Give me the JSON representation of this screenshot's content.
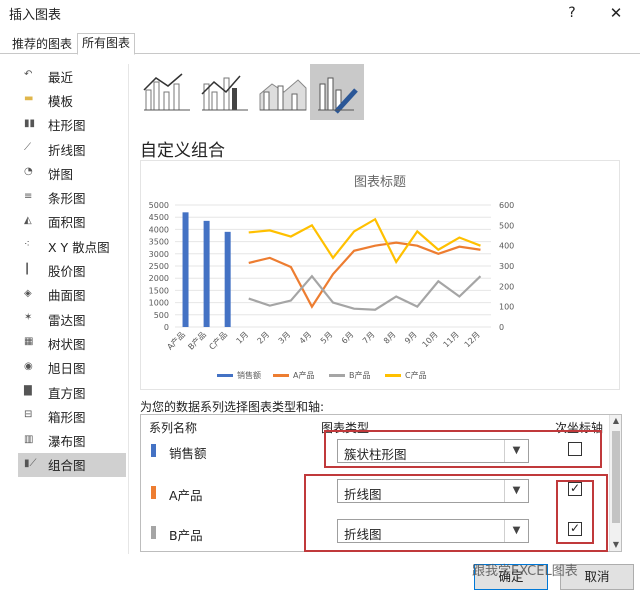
{
  "window": {
    "title": "插入图表",
    "help": "?",
    "close": "✕"
  },
  "tabs": [
    {
      "label": "推荐的图表"
    },
    {
      "label": "所有图表"
    }
  ],
  "sidebar": {
    "items": [
      {
        "label": "最近",
        "icon": "recent-icon"
      },
      {
        "label": "模板",
        "icon": "folder-icon"
      },
      {
        "label": "柱形图",
        "icon": "column-chart-icon"
      },
      {
        "label": "折线图",
        "icon": "line-chart-icon"
      },
      {
        "label": "饼图",
        "icon": "pie-chart-icon"
      },
      {
        "label": "条形图",
        "icon": "bar-chart-icon"
      },
      {
        "label": "面积图",
        "icon": "area-chart-icon"
      },
      {
        "label": "X Y 散点图",
        "icon": "scatter-chart-icon"
      },
      {
        "label": "股价图",
        "icon": "stock-chart-icon"
      },
      {
        "label": "曲面图",
        "icon": "surface-chart-icon"
      },
      {
        "label": "雷达图",
        "icon": "radar-chart-icon"
      },
      {
        "label": "树状图",
        "icon": "treemap-chart-icon"
      },
      {
        "label": "旭日图",
        "icon": "sunburst-chart-icon"
      },
      {
        "label": "直方图",
        "icon": "histogram-chart-icon"
      },
      {
        "label": "箱形图",
        "icon": "boxwhisker-chart-icon"
      },
      {
        "label": "瀑布图",
        "icon": "waterfall-chart-icon"
      },
      {
        "label": "组合图",
        "icon": "combo-chart-icon"
      }
    ],
    "active_index": 16
  },
  "section_title": "自定义组合",
  "select_caption": "为您的数据系列选择图表类型和轴:",
  "table": {
    "headers": {
      "name": "系列名称",
      "type": "图表类型",
      "axis": "次坐标轴"
    },
    "rows": [
      {
        "name": "销售额",
        "type": "簇状柱形图",
        "secondary": false,
        "color": "#4472C4"
      },
      {
        "name": "A产品",
        "type": "折线图",
        "secondary": true,
        "color": "#ED7D31"
      },
      {
        "name": "B产品",
        "type": "折线图",
        "secondary": true,
        "color": "#A5A5A5"
      }
    ]
  },
  "buttons": {
    "ok": "确定",
    "cancel": "取消"
  },
  "watermark": "跟我学EXCEL图表",
  "chart_data": {
    "type": "bar",
    "title": "图表标题",
    "categories": [
      "A产品",
      "B产品",
      "C产品",
      "1月",
      "2月",
      "3月",
      "4月",
      "5月",
      "6月",
      "7月",
      "8月",
      "9月",
      "10月",
      "11月",
      "12月"
    ],
    "series": [
      {
        "name": "销售额",
        "type": "bar",
        "axis": "primary",
        "color": "#4472C4",
        "values": [
          4700,
          4350,
          3900,
          null,
          null,
          null,
          null,
          null,
          null,
          null,
          null,
          null,
          null,
          null,
          null
        ]
      },
      {
        "name": "A产品",
        "type": "line",
        "axis": "secondary",
        "color": "#ED7D31",
        "values": [
          null,
          null,
          null,
          315,
          340,
          295,
          100,
          260,
          375,
          400,
          415,
          400,
          360,
          395,
          380
        ]
      },
      {
        "name": "B产品",
        "type": "line",
        "axis": "secondary",
        "color": "#A5A5A5",
        "values": [
          null,
          null,
          null,
          140,
          105,
          130,
          250,
          120,
          90,
          85,
          150,
          100,
          225,
          150,
          250
        ]
      },
      {
        "name": "C产品",
        "type": "line",
        "axis": "secondary",
        "color": "#FFC000",
        "values": [
          null,
          null,
          null,
          465,
          475,
          445,
          500,
          340,
          470,
          530,
          320,
          470,
          380,
          440,
          400
        ]
      }
    ],
    "y_primary": {
      "min": 0,
      "max": 5000,
      "ticks": [
        "0",
        "500",
        "1000",
        "1500",
        "2000",
        "2500",
        "3000",
        "3500",
        "4000",
        "4500",
        "5000"
      ]
    },
    "y_secondary": {
      "min": 0,
      "max": 600,
      "ticks": [
        "0",
        "100",
        "200",
        "300",
        "400",
        "500",
        "600"
      ]
    },
    "legend": "bottom"
  }
}
